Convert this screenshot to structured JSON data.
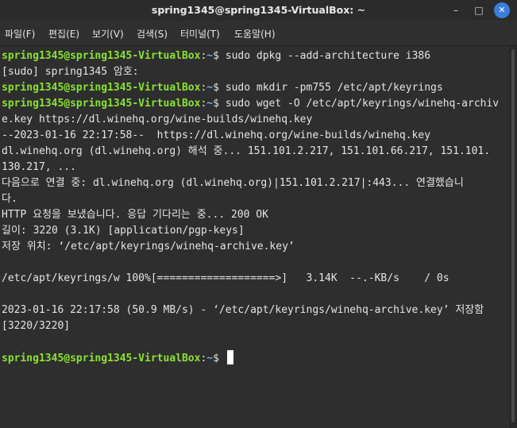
{
  "window": {
    "title": "spring1345@spring1345-VirtualBox: ~",
    "buttons": {
      "minimize": "–",
      "maximize": "□",
      "close": "✕"
    }
  },
  "menu": [
    {
      "label": "파일(F)"
    },
    {
      "label": "편집(E)"
    },
    {
      "label": "보기(V)"
    },
    {
      "label": "검색(S)"
    },
    {
      "label": "터미널(T)"
    },
    {
      "label": "도움말(H)"
    }
  ],
  "terminal": {
    "prompt_user": "spring1345@spring1345-VirtualBox",
    "prompt_sep": ":",
    "prompt_path": "~",
    "prompt_sign": "$ ",
    "lines": [
      {
        "type": "cmd",
        "text": "sudo dpkg --add-architecture i386"
      },
      {
        "type": "out",
        "text": "[sudo] spring1345 암호:"
      },
      {
        "type": "cmd",
        "text": "sudo mkdir -pm755 /etc/apt/keyrings"
      },
      {
        "type": "cmd",
        "text": "sudo wget -O /etc/apt/keyrings/winehq-archiv"
      },
      {
        "type": "out",
        "text": "e.key https://dl.winehq.org/wine-builds/winehq.key"
      },
      {
        "type": "out",
        "text": "--2023-01-16 22:17:58--  https://dl.winehq.org/wine-builds/winehq.key"
      },
      {
        "type": "out",
        "text": "dl.winehq.org (dl.winehq.org) 해석 중... 151.101.2.217, 151.101.66.217, 151.101."
      },
      {
        "type": "out",
        "text": "130.217, ..."
      },
      {
        "type": "out",
        "text": "다음으로 연결 중: dl.winehq.org (dl.winehq.org)|151.101.2.217|:443... 연결했습니"
      },
      {
        "type": "out",
        "text": "다."
      },
      {
        "type": "out",
        "text": "HTTP 요청을 보냈습니다. 응답 기다리는 중... 200 OK"
      },
      {
        "type": "out",
        "text": "길이: 3220 (3.1K) [application/pgp-keys]"
      },
      {
        "type": "out",
        "text": "저장 위치: ‘/etc/apt/keyrings/winehq-archive.key’"
      },
      {
        "type": "out",
        "text": ""
      },
      {
        "type": "out",
        "text": "/etc/apt/keyrings/w 100%[===================>]   3.14K  --.-KB/s    / 0s"
      },
      {
        "type": "out",
        "text": ""
      },
      {
        "type": "out",
        "text": "2023-01-16 22:17:58 (50.9 MB/s) - ‘/etc/apt/keyrings/winehq-archive.key’ 저장함"
      },
      {
        "type": "out",
        "text": "[3220/3220]"
      },
      {
        "type": "out",
        "text": ""
      },
      {
        "type": "cmd",
        "text": ""
      }
    ]
  },
  "colors": {
    "prompt_user": "#8ae234",
    "prompt_path": "#7aa6e0",
    "background": "#2e2e2e",
    "close_button": "#3b7ddd"
  }
}
